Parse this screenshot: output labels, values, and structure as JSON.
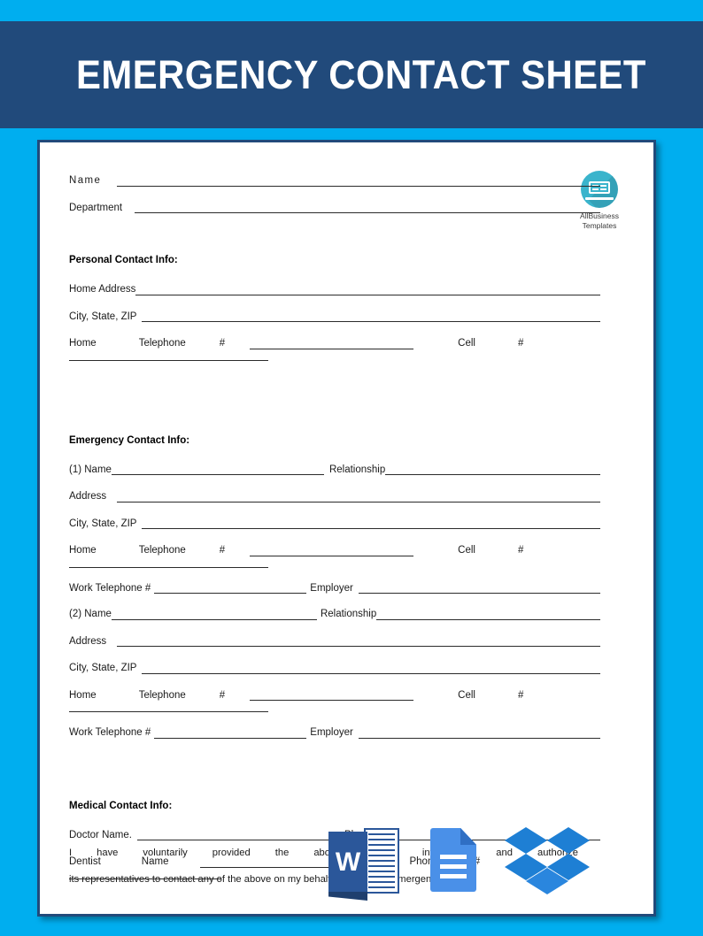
{
  "colors": {
    "page_background": "#00aeef",
    "header_band": "#214a7b",
    "header_text": "#ffffff",
    "paper": "#ffffff",
    "rule": "#2b2b2b",
    "logo_circle": "#3ab4cc",
    "word_blue": "#2b579a",
    "gdocs_blue": "#4a90e8",
    "dropbox_blue": "#1e7fd4"
  },
  "header": {
    "title": "EMERGENCY CONTACT SHEET"
  },
  "logo": {
    "icon": "laptop-icon",
    "line1": "AllBusiness",
    "line2": "Templates"
  },
  "form": {
    "name_label": "Name",
    "department_label": "Department",
    "sections": [
      {
        "title": "Personal Contact Info:",
        "rows": [
          {
            "labels": [
              "Home  Address"
            ]
          },
          {
            "labels": [
              "City, State, ZIP"
            ]
          },
          {
            "labels": [
              "Home",
              "Telephone",
              "#",
              "Cell",
              "#"
            ]
          }
        ]
      },
      {
        "title": "Emergency Contact Info:",
        "rows": [
          {
            "labels": [
              "(1) Name",
              "Relationship"
            ]
          },
          {
            "labels": [
              "Address"
            ]
          },
          {
            "labels": [
              "City, State, ZIP"
            ]
          },
          {
            "labels": [
              "Home",
              "Telephone",
              "#",
              "Cell",
              "#"
            ]
          },
          {
            "labels": [
              "Work Telephone #",
              "Employer"
            ]
          },
          {
            "labels": [
              "(2) Name",
              "Relationship"
            ]
          },
          {
            "labels": [
              "Address"
            ]
          },
          {
            "labels": [
              "City, State, ZIP"
            ]
          },
          {
            "labels": [
              "Home",
              "Telephone",
              "#",
              "Cell",
              "#"
            ]
          },
          {
            "labels": [
              "Work Telephone #",
              "Employer"
            ]
          }
        ]
      },
      {
        "title": "Medical Contact Info:",
        "rows": [
          {
            "labels": [
              "Doctor Name.",
              "Phone #"
            ]
          },
          {
            "labels": [
              "Dentist",
              "Name",
              "Phone",
              "#"
            ]
          }
        ]
      }
    ]
  },
  "labels": {
    "name": "Name",
    "department": "Department",
    "personal_title": "Personal Contact Info:",
    "emergency_title": "Emergency Contact Info:",
    "medical_title": "Medical Contact Info:",
    "home_address": "Home  Address",
    "city_state_zip": "City, State, ZIP",
    "home": "Home",
    "telephone": "Telephone",
    "hash": "#",
    "cell": "Cell",
    "name1": "(1) Name",
    "name2": "(2) Name",
    "relationship": "Relationship",
    "address": "Address",
    "work_telephone": "Work Telephone #",
    "employer": "Employer",
    "doctor_name": "Doctor Name.",
    "phone_hash": "Phone #",
    "dentist": "Dentist",
    "name_plain": "Name",
    "phone": "Phone"
  },
  "consent": {
    "line1": "I have voluntarily provided the above contact information and authorize",
    "line2": "its representatives to contact any of the above on my behalf in case of an emergency or"
  },
  "overlay_icons": [
    {
      "name": "microsoft-word-icon",
      "letter": "W"
    },
    {
      "name": "google-docs-icon"
    },
    {
      "name": "dropbox-icon"
    }
  ]
}
